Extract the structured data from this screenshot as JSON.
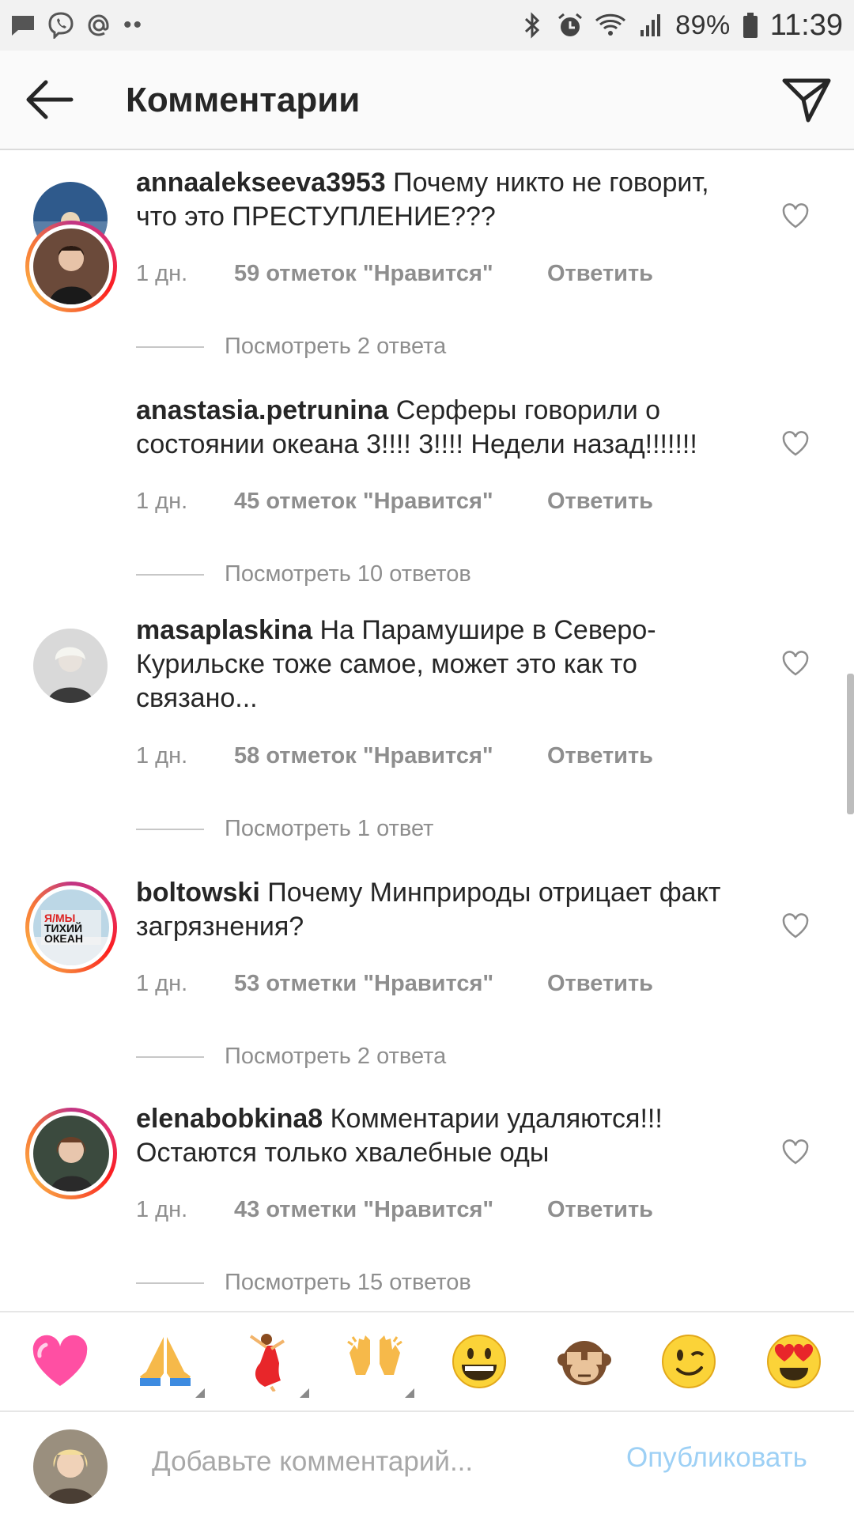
{
  "status_bar": {
    "left_icons": [
      "chat-bubble-icon",
      "viber-icon",
      "at-icon",
      "more-dots-icon"
    ],
    "more_dots": "••",
    "battery_percent": "89%",
    "time": "11:39"
  },
  "header": {
    "title": "Комментарии"
  },
  "comments": [
    {
      "username": "annaalekseeva3953",
      "text": "Почему никто не говорит, что это ПРЕСТУПЛЕНИЕ???",
      "time": "1 дн.",
      "likes": "59 отметок \"Нравится\"",
      "reply": "Ответить",
      "view_replies": "Посмотреть 2 ответа",
      "story_ring": false
    },
    {
      "username": "anastasia.petrunina",
      "text": "Серферы говорили о состоянии океана 3!!!! 3!!!! Недели назад!!!!!!!",
      "time": "1 дн.",
      "likes": "45 отметок \"Нравится\"",
      "reply": "Ответить",
      "view_replies": "Посмотреть 10 ответов",
      "story_ring": true
    },
    {
      "username": "masaplaskina",
      "text": "На Парамушире в Северо-Курильске тоже самое, может это как то связано...",
      "time": "1 дн.",
      "likes": "58 отметок \"Нравится\"",
      "reply": "Ответить",
      "view_replies": "Посмотреть 1 ответ",
      "story_ring": false
    },
    {
      "username": "boltowski",
      "text": "Почему Минприроды отрицает факт загрязнения?",
      "time": "1 дн.",
      "likes": "53 отметки \"Нравится\"",
      "reply": "Ответить",
      "view_replies": "Посмотреть 2 ответа",
      "story_ring": true,
      "avatar_text": [
        "Я/МЫ",
        "ТИХИЙ",
        "ОКЕАН"
      ]
    },
    {
      "username": "elenabobkina8",
      "text": "Комментарии удаляются!!! Остаются только хвалебные оды",
      "time": "1 дн.",
      "likes": "43 отметки \"Нравится\"",
      "reply": "Ответить",
      "view_replies": "Посмотреть 15 ответов",
      "story_ring": true
    }
  ],
  "emoji_bar": [
    {
      "name": "pink-heart-emoji",
      "glyph": "💗",
      "has_variants": false
    },
    {
      "name": "folded-hands-emoji",
      "glyph": "🙏",
      "has_variants": true
    },
    {
      "name": "dancer-emoji",
      "glyph": "💃",
      "has_variants": true
    },
    {
      "name": "raising-hands-emoji",
      "glyph": "🙌",
      "has_variants": true
    },
    {
      "name": "grinning-face-emoji",
      "glyph": "😀",
      "has_variants": false
    },
    {
      "name": "see-no-evil-monkey-emoji",
      "glyph": "🙈",
      "has_variants": false
    },
    {
      "name": "winking-face-emoji",
      "glyph": "😉",
      "has_variants": false
    },
    {
      "name": "heart-eyes-emoji",
      "glyph": "😍",
      "has_variants": false
    }
  ],
  "input": {
    "placeholder": "Добавьте комментарий...",
    "value": "",
    "publish_label": "Опубликовать"
  },
  "colors": {
    "text": "#262626",
    "muted": "#8e8e8e",
    "publish_disabled": "#9dd0f5",
    "ring_gradient": [
      "#c13584",
      "#e1306c",
      "#fd1d1d",
      "#f77737",
      "#fcaf45"
    ]
  }
}
